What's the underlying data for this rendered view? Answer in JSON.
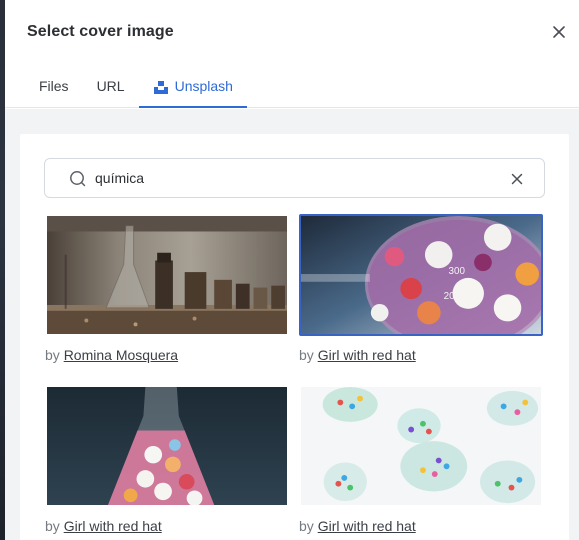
{
  "dialog": {
    "title": "Select cover image"
  },
  "tabs": [
    {
      "label": "Files",
      "active": false
    },
    {
      "label": "URL",
      "active": false
    },
    {
      "label": "Unsplash",
      "active": true,
      "icon": "unsplash-icon"
    }
  ],
  "search": {
    "value": "química",
    "placeholder": ""
  },
  "results": [
    {
      "by": "by",
      "author": "Romina Mosquera",
      "selected": false
    },
    {
      "by": "by",
      "author": "Girl with red hat",
      "selected": true
    },
    {
      "by": "by",
      "author": "Girl with red hat",
      "selected": false
    },
    {
      "by": "by",
      "author": "Girl with red hat",
      "selected": false
    }
  ],
  "colors": {
    "accent": "#2f6bd6",
    "selected_border": "#3a63c6"
  }
}
